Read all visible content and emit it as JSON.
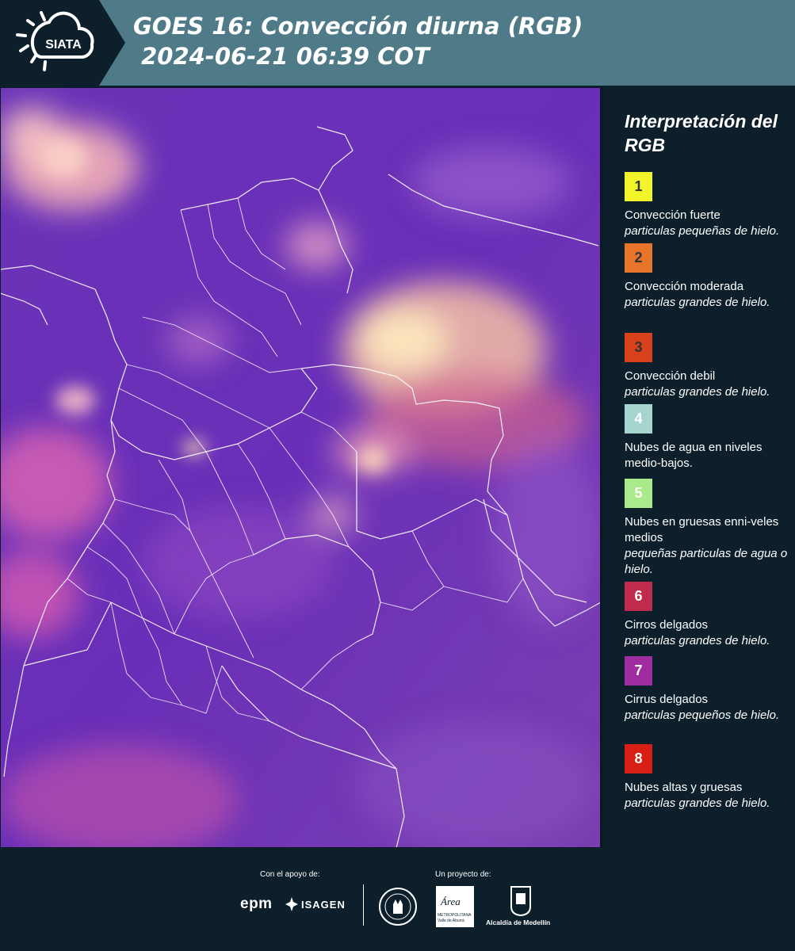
{
  "header": {
    "logo_text": "SIATA",
    "title": "GOES 16: Convección diurna (RGB)\n 2024-06-21 06:39 COT"
  },
  "legend": {
    "title": "Interpretación del RGB",
    "items": [
      {
        "number": "1",
        "color": "#f2f52a",
        "text_color": "#333333",
        "desc": "Convección fuerte",
        "sub": "particulas pequeñas de hielo."
      },
      {
        "number": "2",
        "color": "#e6752b",
        "text_color": "#333333",
        "desc": "Convección moderada",
        "sub": "particulas grandes de hielo."
      },
      {
        "number": "3",
        "color": "#d9411c",
        "text_color": "#333333",
        "desc": "Convección debil",
        "sub": "particulas grandes de hielo."
      },
      {
        "number": "4",
        "color": "#a6d4cf",
        "text_color": "#ffffff",
        "desc": "Nubes de agua en niveles medio-bajos.",
        "sub": ""
      },
      {
        "number": "5",
        "color": "#a9ea8a",
        "text_color": "#ffffff",
        "desc": "Nubes en gruesas enni-veles medios",
        "sub": "pequeñas particulas de agua o hielo."
      },
      {
        "number": "6",
        "color": "#bf2b4c",
        "text_color": "#ffffff",
        "desc": "Cirros delgados",
        "sub": "particulas grandes de hielo."
      },
      {
        "number": "7",
        "color": "#a02da0",
        "text_color": "#ffffff",
        "desc": "Cirrus delgados",
        "sub": "particulas pequeños de hielo."
      },
      {
        "number": "8",
        "color": "#d71f16",
        "text_color": "#ffffff",
        "desc": "Nubes altas y gruesas",
        "sub": "particulas grandes de hielo."
      }
    ]
  },
  "footer": {
    "support_label": "Con el apoyo de:",
    "project_label": "Un proyecto de:",
    "epm": "epm",
    "isagen": "ISAGEN",
    "area_word": "Área",
    "area_line1": "METROPOLITANA",
    "area_line2": "Valle de Aburrá",
    "alcaldia": "Alcaldía de Medellín"
  },
  "colors": {
    "header_bg": "#4f7b89",
    "panel_bg": "#0c1f2b",
    "map_base": "#6a2fb4"
  }
}
